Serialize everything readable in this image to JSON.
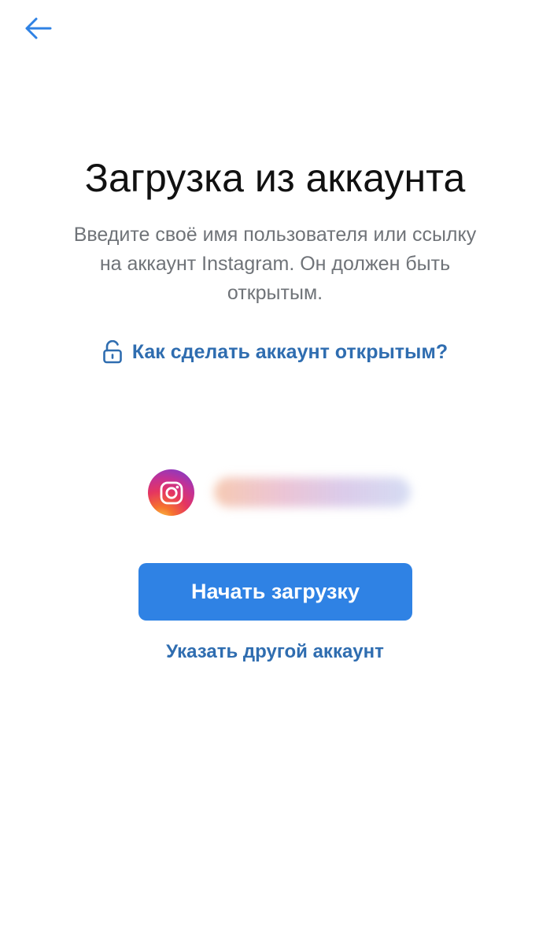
{
  "header": {
    "back_icon": "arrow-left-icon"
  },
  "main": {
    "title": "Загрузка из аккаунта",
    "subtitle_lines": [
      "Введите своё имя пользователя или ссылку",
      "на аккаунт Instagram. Он должен быть",
      "открытым."
    ],
    "help_link": {
      "icon": "unlock-icon",
      "label": "Как сделать аккаунт открытым?"
    },
    "account": {
      "icon": "instagram-icon"
    },
    "start_button_label": "Начать загрузку",
    "other_account_label": "Указать другой аккаунт"
  },
  "colors": {
    "accent": "#2f82e4",
    "link": "#2f6db0",
    "title": "#111111",
    "subtitle": "#6f7378",
    "background": "#ffffff"
  }
}
